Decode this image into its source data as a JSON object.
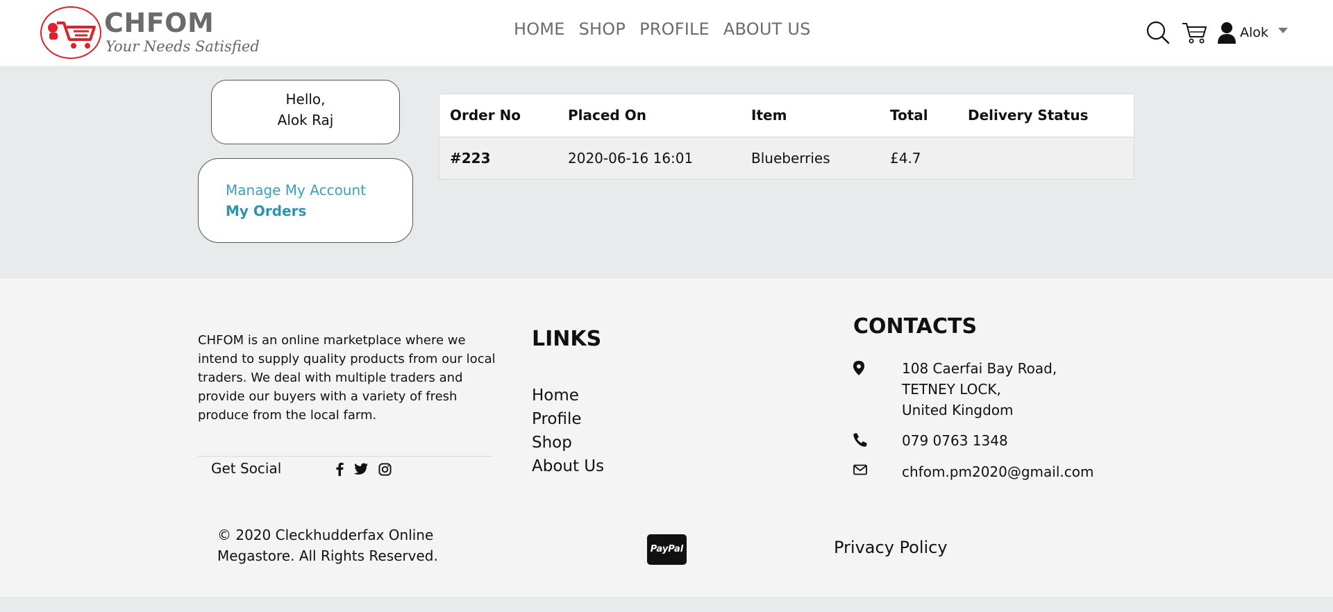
{
  "brand": {
    "name": "CHFOM",
    "tagline": "Your Needs Satisfied",
    "accent_color": "#e0202a"
  },
  "nav": {
    "items": [
      {
        "label": "HOME"
      },
      {
        "label": "SHOP"
      },
      {
        "label": "PROFILE"
      },
      {
        "label": "ABOUT US"
      }
    ]
  },
  "header_icons": {
    "search": "search-icon",
    "cart": "cart-icon",
    "user": "user-icon",
    "user_name": "Alok"
  },
  "sidebar": {
    "greeting": "Hello,",
    "full_name": "Alok Raj",
    "menu": [
      {
        "label": "Manage My Account",
        "active": false
      },
      {
        "label": "My Orders",
        "active": true
      }
    ],
    "link_color": "#3aa0b8"
  },
  "orders": {
    "columns": [
      "Order No",
      "Placed On",
      "Item",
      "Total",
      "Delivery Status"
    ],
    "rows": [
      {
        "order_no": "#223",
        "placed_on": "2020-06-16 16:01",
        "item": "Blueberries",
        "total": "£4.7",
        "status": ""
      }
    ]
  },
  "footer": {
    "about": "CHFOM is an online marketplace where we intend to supply quality products from our local traders. We deal with multiple traders and provide our buyers with a variety of fresh produce from the local farm.",
    "social_label": "Get Social",
    "social_icons": [
      "facebook-icon",
      "twitter-icon",
      "instagram-icon"
    ],
    "links_title": "LINKS",
    "links": [
      "Home",
      "Profile",
      "Shop",
      "About Us"
    ],
    "contacts_title": "CONTACTS",
    "address": [
      "108 Caerfai Bay Road,",
      "TETNEY LOCK,",
      "United Kingdom"
    ],
    "phone": "079 0763 1348",
    "email": "chfom.pm2020@gmail.com",
    "copyright": "© 2020 Cleckhudderfax Online Megastore. All Rights Reserved.",
    "payment_badge": "PayPal",
    "privacy": "Privacy Policy"
  }
}
